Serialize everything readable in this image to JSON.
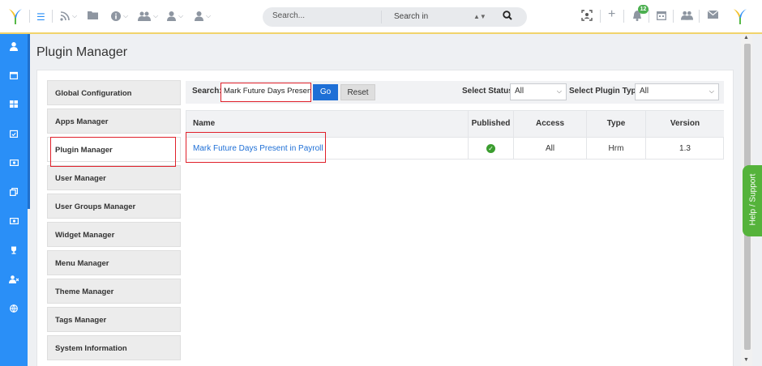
{
  "header": {
    "search_placeholder": "Search...",
    "search_in_label": "Search in",
    "notification_count": "12",
    "colors": {
      "logo_yellow": "#f4c430",
      "logo_blue": "#2a8ff7",
      "logo_green": "#57b947",
      "badge": "#4caf50"
    }
  },
  "page": {
    "title": "Plugin Manager"
  },
  "menu": {
    "items": [
      {
        "label": "Global Configuration"
      },
      {
        "label": "Apps Manager"
      },
      {
        "label": "Plugin Manager"
      },
      {
        "label": "User Manager"
      },
      {
        "label": "User Groups Manager"
      },
      {
        "label": "Widget Manager"
      },
      {
        "label": "Menu Manager"
      },
      {
        "label": "Theme Manager"
      },
      {
        "label": "Tags Manager"
      },
      {
        "label": "System Information"
      }
    ]
  },
  "filter": {
    "search_label": "Search:",
    "search_value": "Mark Future Days Presen",
    "go_label": "Go",
    "reset_label": "Reset",
    "status_label": "Select Status:",
    "status_value": "All",
    "type_label": "Select Plugin Type:",
    "type_value": "All"
  },
  "table": {
    "headers": {
      "name": "Name",
      "published": "Published",
      "access": "Access",
      "type": "Type",
      "version": "Version"
    },
    "rows": [
      {
        "name": "Mark Future Days Present in Payroll",
        "published_icon": "check-circle-icon",
        "access": "All",
        "type": "Hrm",
        "version": "1.3"
      }
    ]
  },
  "help": {
    "label": "Help / Support"
  }
}
